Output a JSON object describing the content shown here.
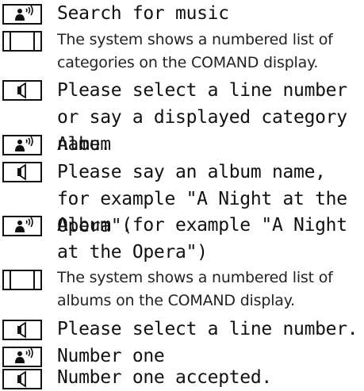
{
  "dialog": [
    {
      "type": "speaker",
      "icon": "voice-command-icon",
      "text": "Search for music"
    },
    {
      "type": "display",
      "icon": "display-screen-icon",
      "text": "The system shows a numbered list of categories on the COMAND display."
    },
    {
      "type": "system",
      "icon": "loudspeaker-icon",
      "text": "Please select a line number or say a displayed category name."
    },
    {
      "type": "speaker",
      "icon": "voice-command-icon",
      "text": "Album"
    },
    {
      "type": "system",
      "icon": "loudspeaker-icon",
      "text": "Please say an album name, for example \"A Night at the Opera\"."
    },
    {
      "type": "speaker",
      "icon": "voice-command-icon",
      "text": "Album (for example \"A Night at the Opera\")"
    },
    {
      "type": "display",
      "icon": "display-screen-icon",
      "text": "The system shows a numbered list of albums on the COMAND display."
    },
    {
      "type": "system",
      "icon": "loudspeaker-icon",
      "text": "Please select a line number."
    },
    {
      "type": "speaker",
      "icon": "voice-command-icon",
      "text": "Number one"
    },
    {
      "type": "system",
      "icon": "loudspeaker-icon",
      "text": "Number one accepted."
    }
  ]
}
